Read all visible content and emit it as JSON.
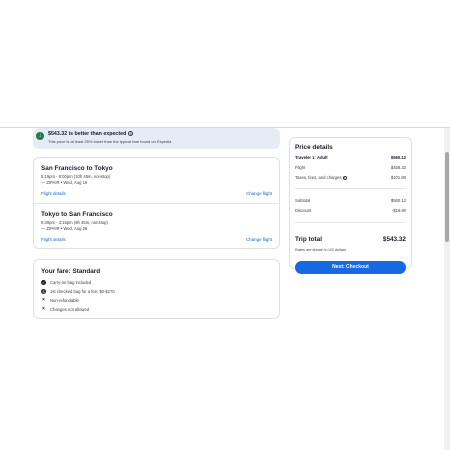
{
  "banner": {
    "title": "$543.32 is better than expected",
    "subtitle": "This price is at least 25% lower than the typical fare found on Expedia",
    "badge_icon": "arrow-down-icon",
    "color": "#227950"
  },
  "flights": [
    {
      "route": "San Francisco to Tokyo",
      "times": "5:15pm - 8:00pm (10h 45m, nonstop)",
      "carrier": "— ZIPAIR • Wed, Aug 19",
      "details_label": "Flight details",
      "change_label": "Change flight"
    },
    {
      "route": "Tokyo to San Francisco",
      "times": "9:30pm - 3:15pm (9h 45m, nonstop)",
      "carrier": "— ZIPAIR • Wed, Aug 26",
      "details_label": "Flight details",
      "change_label": "Change flight"
    }
  ],
  "fare": {
    "title": "Your fare: Standard",
    "items": [
      {
        "icon": "check-circle-icon",
        "label": "Carry-on bag included"
      },
      {
        "icon": "dollar-circle-icon",
        "label": "1st checked bag for a fee: $0-$170"
      },
      {
        "icon": "x-icon",
        "label": "Non-refundable"
      },
      {
        "icon": "x-icon",
        "label": "Changes not allowed"
      }
    ]
  },
  "price": {
    "title": "Price details",
    "traveler": {
      "label": "Traveler 1: Adult",
      "value": "$560.12"
    },
    "flight": {
      "label": "Flight",
      "value": "$458.32"
    },
    "taxes": {
      "label": "Taxes, fees, and charges",
      "value": "$101.80"
    },
    "subtotal": {
      "label": "Subtotal",
      "value": "$560.12"
    },
    "discount": {
      "label": "Discount",
      "value": "-$16.80"
    },
    "total": {
      "label": "Trip total",
      "value": "$543.32"
    },
    "rates_note": "Rates are shown in US dollars",
    "checkout_label": "Next: Checkout",
    "accent": "#1668e3"
  }
}
